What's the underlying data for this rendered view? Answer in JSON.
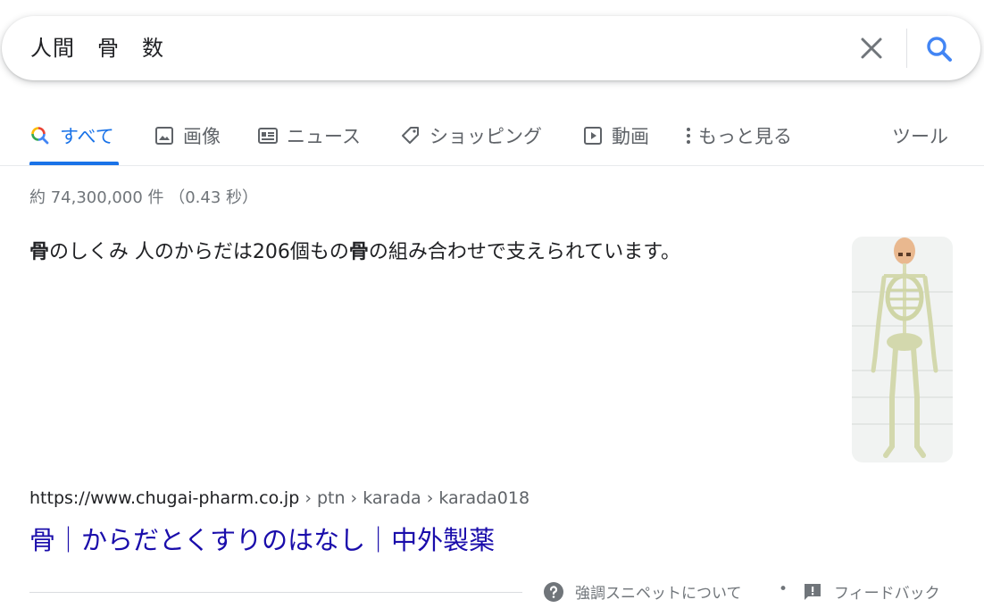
{
  "search": {
    "query": "人間　骨　数"
  },
  "tabs": [
    {
      "label": "すべて",
      "icon": "search-multicolor-icon",
      "active": true
    },
    {
      "label": "画像",
      "icon": "image-icon"
    },
    {
      "label": "ニュース",
      "icon": "news-icon"
    },
    {
      "label": "ショッピング",
      "icon": "tag-icon"
    },
    {
      "label": "動画",
      "icon": "video-icon"
    },
    {
      "label": "もっと見る",
      "icon": "more-vert-icon"
    }
  ],
  "tools_label": "ツール",
  "result_stats": "約 74,300,000 件 （0.43 秒）",
  "snippet": {
    "bold1": "骨",
    "text1": "のしくみ 人のからだは206個もの",
    "bold2": "骨",
    "text2": "の組み合わせで支えられています。"
  },
  "result": {
    "url_base": "https://www.chugai-pharm.co.jp",
    "breadcrumb": " › ptn › karada › karada018",
    "title": "骨｜からだとくすりのはなし｜中外製薬"
  },
  "footer": {
    "about_label": "強調スニペットについて",
    "separator": "•",
    "feedback_label": "フィードバック"
  },
  "colors": {
    "accent": "#1a73e8",
    "link": "#1a0dab",
    "secondary_text": "#70757a"
  }
}
